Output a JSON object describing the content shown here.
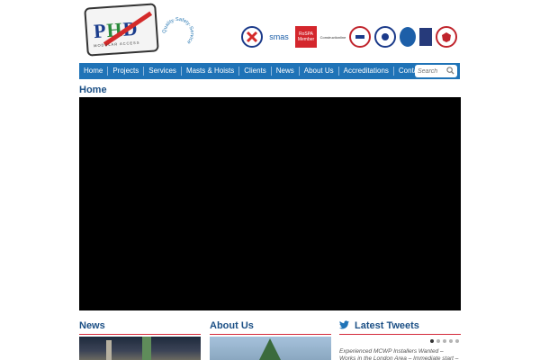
{
  "logo": {
    "letters": [
      "P",
      "H",
      "D"
    ],
    "tagline": "MODULAR ACCESS",
    "ring_text": "Quality·Safety·Service"
  },
  "badges": {
    "smas": "smas",
    "rospa": "RoSPA Member",
    "constructionline": "Constructionline"
  },
  "nav": {
    "items": [
      "Home",
      "Projects",
      "Services",
      "Masts & Hoists",
      "Clients",
      "News",
      "About Us",
      "Accreditations",
      "Contact"
    ],
    "search_placeholder": "Search"
  },
  "page": {
    "title": "Home"
  },
  "columns": {
    "news_title": "News",
    "about_title": "About Us",
    "tweets_title": "Latest Tweets"
  },
  "tweets": {
    "text": "Experienced MCWP Installers Wanted – Works in the London Area – Immediate start – Good",
    "dots_total": 5,
    "dots_active": 1
  },
  "colors": {
    "nav": "#1f73b7",
    "title": "#1b4f85",
    "accent_red": "#d42a3a",
    "twitter": "#1f73b7"
  }
}
